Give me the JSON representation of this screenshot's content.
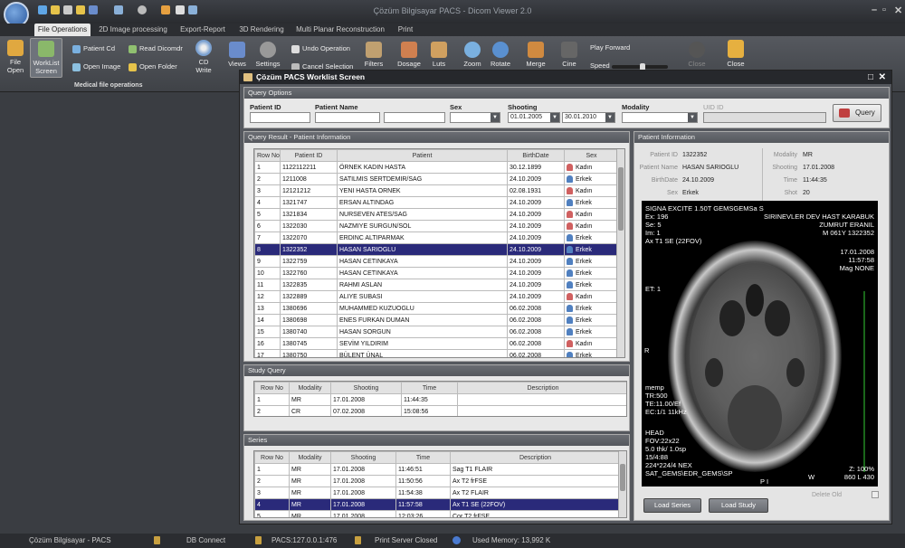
{
  "app": {
    "title": "Çözüm Bilgisayar PACS - Dicom Viewer 2.0"
  },
  "tabs": [
    "File Operations",
    "2D Image processing",
    "Export-Report",
    "3D Rendering",
    "Multi Planar Reconstruction",
    "Print"
  ],
  "ribbon": {
    "file_open": "File\nOpen",
    "worklist": "WorkList\nScreen",
    "patient_cd": "Patient Cd",
    "open_image": "Open Image",
    "read_dicomdir": "Read Dicomdr",
    "open_folder": "Open Folder",
    "cd_write": "CD\nWrite",
    "views": "Views",
    "settings": "Settings",
    "undo": "Undo Operation",
    "cancel_selection": "Cancel Selection",
    "filters": "Filters",
    "dosage": "Dosage",
    "luts": "Luts",
    "zoom": "Zoom",
    "rotate": "Rotate",
    "merge": "Merge",
    "cine": "Cine",
    "play_forward": "Play Forward",
    "speed": "Speed",
    "close_disabled": "Close",
    "close": "Close",
    "group_label": "Medical file operations",
    "speed_level": 0.55
  },
  "dialog": {
    "title": "Çözüm PACS Worklist Screen",
    "query_options": {
      "header": "Query Options",
      "patient_id_label": "Patient ID",
      "patient_name_label": "Patient Name",
      "sex_label": "Sex",
      "shooting_label": "Shooting",
      "modality_label": "Modality",
      "uid_label": "UID ID",
      "shooting_from": "01.01.2005",
      "shooting_to": "30.01.2010",
      "query_button": "Query"
    },
    "results": {
      "header": "Query Result - Patient Information",
      "columns": [
        "Row No",
        "Patient ID",
        "Patient",
        "BirthDate",
        "Sex"
      ],
      "selected_index": 7,
      "rows": [
        {
          "no": "1",
          "id": "1122112211",
          "name": "ÖRNEK KADIN HASTA",
          "birth": "30.12.1899",
          "sex": "Kadın"
        },
        {
          "no": "2",
          "id": "1211008",
          "name": "SATILMIS SERTDEMIR/SAG",
          "birth": "24.10.2009",
          "sex": "Erkek"
        },
        {
          "no": "3",
          "id": "12121212",
          "name": "YENI HASTA ORNEK",
          "birth": "02.08.1931",
          "sex": "Kadın"
        },
        {
          "no": "4",
          "id": "1321747",
          "name": "ERSAN ALTINDAG",
          "birth": "24.10.2009",
          "sex": "Erkek"
        },
        {
          "no": "5",
          "id": "1321834",
          "name": "NURSEVEN ATES/SAG",
          "birth": "24.10.2009",
          "sex": "Kadın"
        },
        {
          "no": "6",
          "id": "1322030",
          "name": "NAZMIYE SURGUN/SOL",
          "birth": "24.10.2009",
          "sex": "Kadın"
        },
        {
          "no": "7",
          "id": "1322070",
          "name": "ERDINC ALTIPARMAK",
          "birth": "24.10.2009",
          "sex": "Erkek"
        },
        {
          "no": "8",
          "id": "1322352",
          "name": "HASAN SARIOGLU",
          "birth": "24.10.2009",
          "sex": "Erkek"
        },
        {
          "no": "9",
          "id": "1322759",
          "name": "HASAN CETINKAYA",
          "birth": "24.10.2009",
          "sex": "Erkek"
        },
        {
          "no": "10",
          "id": "1322760",
          "name": "HASAN CETINKAYA",
          "birth": "24.10.2009",
          "sex": "Erkek"
        },
        {
          "no": "11",
          "id": "1322835",
          "name": "RAHMI ASLAN",
          "birth": "24.10.2009",
          "sex": "Erkek"
        },
        {
          "no": "12",
          "id": "1322889",
          "name": "ALIYE SUBASI",
          "birth": "24.10.2009",
          "sex": "Kadın"
        },
        {
          "no": "13",
          "id": "1380696",
          "name": "MUHAMMED KUZUOGLU",
          "birth": "06.02.2008",
          "sex": "Erkek"
        },
        {
          "no": "14",
          "id": "1380698",
          "name": "ENES FURKAN DUMAN",
          "birth": "06.02.2008",
          "sex": "Erkek"
        },
        {
          "no": "15",
          "id": "1380740",
          "name": "HASAN SORGUN",
          "birth": "06.02.2008",
          "sex": "Erkek"
        },
        {
          "no": "16",
          "id": "1380745",
          "name": "SEVİM YILDIRIM",
          "birth": "06.02.2008",
          "sex": "Kadın"
        },
        {
          "no": "17",
          "id": "1380750",
          "name": "BÜLENT ÜNAL",
          "birth": "06.02.2008",
          "sex": "Erkek"
        }
      ]
    },
    "study": {
      "header": "Study Query",
      "columns": [
        "Row No",
        "Modality",
        "Shooting",
        "Time",
        "Description"
      ],
      "rows": [
        {
          "no": "1",
          "mod": "MR",
          "date": "17.01.2008",
          "time": "11:44:35",
          "desc": ""
        },
        {
          "no": "2",
          "mod": "CR",
          "date": "07.02.2008",
          "time": "15:08:56",
          "desc": ""
        }
      ]
    },
    "series": {
      "header": "Series",
      "columns": [
        "Row No",
        "Modality",
        "Shooting",
        "Time",
        "Description"
      ],
      "selected_index": 3,
      "rows": [
        {
          "no": "1",
          "mod": "MR",
          "date": "17.01.2008",
          "time": "11:46:51",
          "desc": "Sag T1 FLAIR"
        },
        {
          "no": "2",
          "mod": "MR",
          "date": "17.01.2008",
          "time": "11:50:56",
          "desc": "Ax T2 frFSE"
        },
        {
          "no": "3",
          "mod": "MR",
          "date": "17.01.2008",
          "time": "11:54:38",
          "desc": "Ax T2 FLAIR"
        },
        {
          "no": "4",
          "mod": "MR",
          "date": "17.01.2008",
          "time": "11:57:58",
          "desc": "Ax T1 SE (22FOV)"
        },
        {
          "no": "5",
          "mod": "MR",
          "date": "17.01.2008",
          "time": "12:03:26",
          "desc": "Cor T2 frFSE"
        }
      ]
    },
    "patient_info": {
      "header": "Patient Information",
      "patient_id_label": "Patient ID",
      "patient_id": "1322352",
      "patient_name_label": "Patient Name",
      "patient_name": "HASAN SARIOGLU",
      "birth_label": "BirthDate",
      "birth": "24.10.2009",
      "sex_label": "Sex",
      "sex": "Erkek",
      "modality_label": "Modality",
      "modality": "MR",
      "shooting_label": "Shooting",
      "shooting": "17.01.2008",
      "time_label": "Time",
      "time": "11:44:35",
      "shot_label": "Shot",
      "shot": "20",
      "load_series": "Load Series",
      "load_study": "Load Study",
      "delete_old": "Delete Old"
    },
    "viewer_overlay": {
      "tl": [
        "SIGNA EXCITE 1.50T GEMSGEMSа S",
        "Ex: 196",
        "Se: 5",
        "Im: 1",
        "Ax T1 SE (22FOV)"
      ],
      "tr": [
        "SIRINEVLER DEV HAST KARABUK",
        "ZUMRUT ERANIL",
        "M 061Y 1322352"
      ],
      "tr2": [
        "17.01.2008",
        "11:57:58",
        "Mag NONE"
      ],
      "et": "ET: 1",
      "r": "R",
      "ml": [
        "memp",
        "TR:500",
        "TE:11.00/Ef",
        "EC:1/1 11kHz"
      ],
      "bl": [
        "HEAD",
        "FOV:22x22",
        "5.0 thk/ 1.0sp",
        "15/4:88",
        "224*224/4 NEX",
        "SAT_GEMS\\EDR_GEMS\\SP"
      ],
      "pi": "P I",
      "w": "W",
      "zoom": "Z: 100%",
      "wl": "860  L   430"
    }
  },
  "status": {
    "company": "Çözüm Bilgisayar - PACS",
    "db": "DB Connect",
    "pacs": "PACS:127.0.0.1:476",
    "print": "Print Server Closed",
    "memory": "Used Memory: 13,992 K"
  },
  "colors": {
    "accent": "#2a2a7a",
    "female_icon": "#d06060",
    "male_icon": "#5080c0"
  }
}
